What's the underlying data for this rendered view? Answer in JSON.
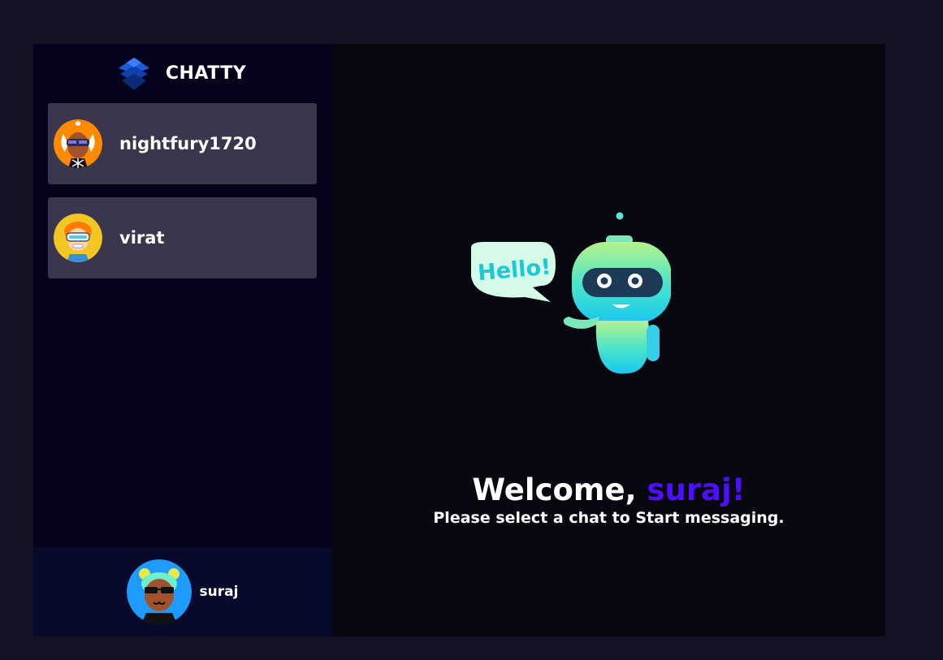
{
  "brand": {
    "title": "CHATTY",
    "logo_icon": "layered-diamond-logo-icon"
  },
  "contacts": [
    {
      "username": "nightfury1720",
      "avatar_icon": "orange-avatar-icon",
      "avatar_color": "#ff8a00"
    },
    {
      "username": "virat",
      "avatar_icon": "yellow-avatar-icon",
      "avatar_color": "#f3c623"
    }
  ],
  "current_user": {
    "username": "suraj",
    "avatar_icon": "blue-avatar-icon",
    "avatar_color": "#1e9bff"
  },
  "welcome": {
    "greeting": "Welcome, ",
    "username": "suraj!",
    "subtitle": "Please select a chat to Start messaging.",
    "illustration_text": "Hello!"
  },
  "colors": {
    "background": "#131324",
    "sidebar": "#05031c",
    "contact_card": "#3b364d",
    "current_user_bar": "#080a2c",
    "accent": "#4e0eff"
  }
}
